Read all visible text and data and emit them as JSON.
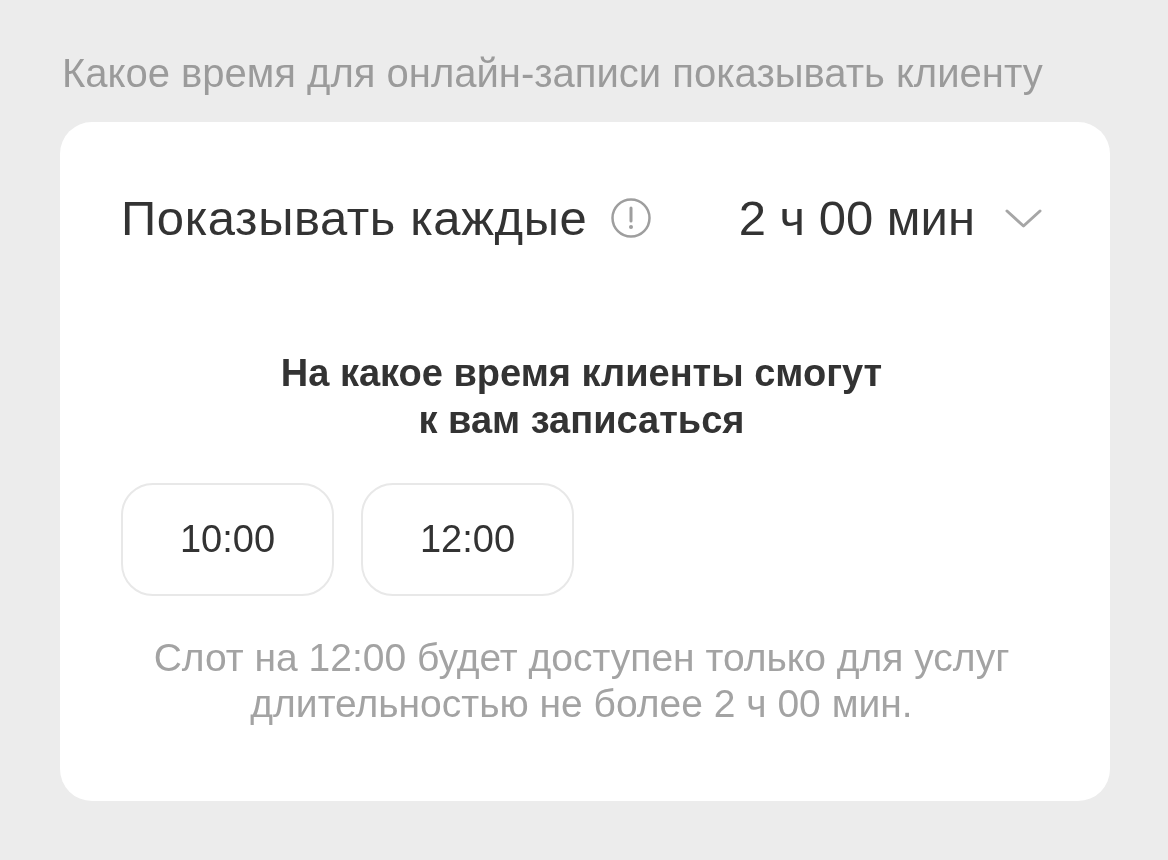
{
  "section_label": "Какое время для онлайн-записи показывать клиенту",
  "interval": {
    "label": "Показывать каждые",
    "value": "2 ч 00 мин"
  },
  "slots": {
    "title": "На какое время клиенты смогут к вам записаться",
    "times": [
      "10:00",
      "12:00"
    ],
    "note": "Слот на 12:00 будет доступен только для услуг длительностью не более 2 ч 00 мин."
  }
}
